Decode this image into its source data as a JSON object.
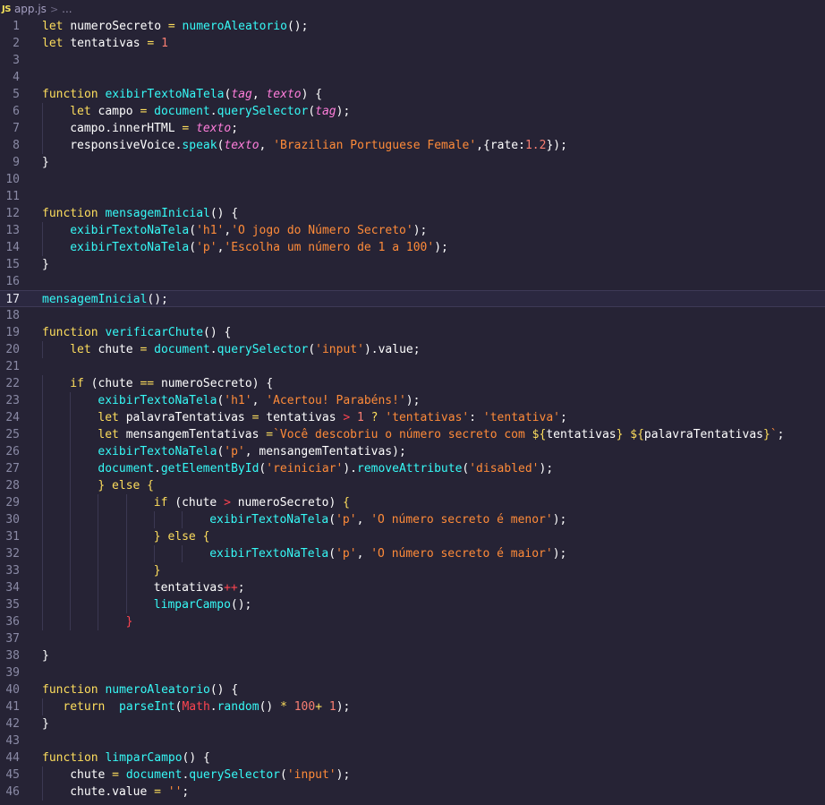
{
  "breadcrumb": {
    "icon": "JS",
    "file": "app.js",
    "separator": ">",
    "more": "..."
  },
  "editor": {
    "current_line": 17,
    "lines": [
      {
        "n": "1",
        "tokens": [
          [
            "k",
            "let "
          ],
          [
            "v",
            "numeroSecreto "
          ],
          [
            "o",
            "= "
          ],
          [
            "f",
            "numeroAleatorio"
          ],
          [
            "v",
            "();"
          ]
        ]
      },
      {
        "n": "2",
        "tokens": [
          [
            "k",
            "let "
          ],
          [
            "v",
            "tentativas "
          ],
          [
            "o",
            "= "
          ],
          [
            "n",
            "1"
          ]
        ]
      },
      {
        "n": "3",
        "tokens": []
      },
      {
        "n": "4",
        "tokens": []
      },
      {
        "n": "5",
        "tokens": [
          [
            "k",
            "function "
          ],
          [
            "f",
            "exibirTextoNaTela"
          ],
          [
            "v",
            "("
          ],
          [
            "p",
            "tag"
          ],
          [
            "v",
            ", "
          ],
          [
            "p",
            "texto"
          ],
          [
            "v",
            ") {"
          ]
        ]
      },
      {
        "n": "6",
        "indent": 1,
        "tokens": [
          [
            "k",
            "let "
          ],
          [
            "v",
            "campo "
          ],
          [
            "o",
            "= "
          ],
          [
            "f",
            "document"
          ],
          [
            "v",
            "."
          ],
          [
            "f",
            "querySelector"
          ],
          [
            "v",
            "("
          ],
          [
            "p",
            "tag"
          ],
          [
            "v",
            ");"
          ]
        ]
      },
      {
        "n": "7",
        "indent": 1,
        "tokens": [
          [
            "v",
            "campo.innerHTML "
          ],
          [
            "o",
            "= "
          ],
          [
            "p",
            "texto"
          ],
          [
            "v",
            ";"
          ]
        ]
      },
      {
        "n": "8",
        "indent": 1,
        "tokens": [
          [
            "v",
            "responsiveVoice."
          ],
          [
            "f",
            "speak"
          ],
          [
            "v",
            "("
          ],
          [
            "p",
            "texto"
          ],
          [
            "v",
            ", "
          ],
          [
            "s",
            "'Brazilian Portuguese Female'"
          ],
          [
            "v",
            ",{rate:"
          ],
          [
            "n",
            "1.2"
          ],
          [
            "v",
            "});"
          ]
        ]
      },
      {
        "n": "9",
        "tokens": [
          [
            "v",
            "}"
          ]
        ]
      },
      {
        "n": "10",
        "tokens": []
      },
      {
        "n": "11",
        "tokens": []
      },
      {
        "n": "12",
        "tokens": [
          [
            "k",
            "function "
          ],
          [
            "f",
            "mensagemInicial"
          ],
          [
            "v",
            "() {"
          ]
        ]
      },
      {
        "n": "13",
        "indent": 1,
        "tokens": [
          [
            "f",
            "exibirTextoNaTela"
          ],
          [
            "v",
            "("
          ],
          [
            "s",
            "'h1'"
          ],
          [
            "v",
            ","
          ],
          [
            "s",
            "'O jogo do Número Secreto'"
          ],
          [
            "v",
            ");"
          ]
        ]
      },
      {
        "n": "14",
        "indent": 1,
        "tokens": [
          [
            "f",
            "exibirTextoNaTela"
          ],
          [
            "v",
            "("
          ],
          [
            "s",
            "'p'"
          ],
          [
            "v",
            ","
          ],
          [
            "s",
            "'Escolha um número de 1 a 100'"
          ],
          [
            "v",
            ");"
          ]
        ]
      },
      {
        "n": "15",
        "tokens": [
          [
            "v",
            "}"
          ]
        ]
      },
      {
        "n": "16",
        "tokens": []
      },
      {
        "n": "17",
        "tokens": [
          [
            "f",
            "mensagemInicial"
          ],
          [
            "v",
            "();"
          ]
        ]
      },
      {
        "n": "18",
        "tokens": []
      },
      {
        "n": "19",
        "tokens": [
          [
            "k",
            "function "
          ],
          [
            "f",
            "verificarChute"
          ],
          [
            "v",
            "() {"
          ]
        ]
      },
      {
        "n": "20",
        "indent": 1,
        "tokens": [
          [
            "k",
            "let "
          ],
          [
            "v",
            "chute "
          ],
          [
            "o",
            "= "
          ],
          [
            "f",
            "document"
          ],
          [
            "v",
            "."
          ],
          [
            "f",
            "querySelector"
          ],
          [
            "v",
            "("
          ],
          [
            "s",
            "'input'"
          ],
          [
            "v",
            ").value;"
          ]
        ]
      },
      {
        "n": "21",
        "tokens": []
      },
      {
        "n": "22",
        "indent": 1,
        "tokens": [
          [
            "k",
            "if "
          ],
          [
            "v",
            "(chute "
          ],
          [
            "o",
            "== "
          ],
          [
            "v",
            "numeroSecreto) {"
          ]
        ]
      },
      {
        "n": "23",
        "indent": 2,
        "tokens": [
          [
            "f",
            "exibirTextoNaTela"
          ],
          [
            "v",
            "("
          ],
          [
            "s",
            "'h1'"
          ],
          [
            "v",
            ", "
          ],
          [
            "s",
            "'Acertou! Parabéns!'"
          ],
          [
            "v",
            ");"
          ]
        ]
      },
      {
        "n": "24",
        "indent": 2,
        "tokens": [
          [
            "k",
            "let "
          ],
          [
            "v",
            "palavraTentativas "
          ],
          [
            "o",
            "= "
          ],
          [
            "v",
            "tentativas "
          ],
          [
            "op",
            "> "
          ],
          [
            "n",
            "1 "
          ],
          [
            "o",
            "? "
          ],
          [
            "s",
            "'tentativas'"
          ],
          [
            "v",
            ": "
          ],
          [
            "s",
            "'tentativa'"
          ],
          [
            "v",
            ";"
          ]
        ]
      },
      {
        "n": "25",
        "indent": 2,
        "tokens": [
          [
            "k",
            "let "
          ],
          [
            "v",
            "mensangemTentativas "
          ],
          [
            "o",
            "="
          ],
          [
            "s",
            "`Você descobriu o número secreto com "
          ],
          [
            "k",
            "${"
          ],
          [
            "v",
            "tentativas"
          ],
          [
            "k",
            "} ${"
          ],
          [
            "v",
            "palavraTentativas"
          ],
          [
            "k",
            "}"
          ],
          [
            "s",
            "`"
          ],
          [
            "v",
            ";"
          ]
        ]
      },
      {
        "n": "26",
        "indent": 2,
        "tokens": [
          [
            "f",
            "exibirTextoNaTela"
          ],
          [
            "v",
            "("
          ],
          [
            "s",
            "'p'"
          ],
          [
            "v",
            ", mensangemTentativas);"
          ]
        ]
      },
      {
        "n": "27",
        "indent": 2,
        "tokens": [
          [
            "f",
            "document"
          ],
          [
            "v",
            "."
          ],
          [
            "f",
            "getElementById"
          ],
          [
            "v",
            "("
          ],
          [
            "s",
            "'reiniciar'"
          ],
          [
            "v",
            ")."
          ],
          [
            "f",
            "removeAttribute"
          ],
          [
            "v",
            "("
          ],
          [
            "s",
            "'disabled'"
          ],
          [
            "v",
            ");"
          ]
        ]
      },
      {
        "n": "28",
        "indent": 2,
        "tokens": [
          [
            "k",
            "} else {"
          ]
        ]
      },
      {
        "n": "29",
        "indent": 4,
        "tokens": [
          [
            "k",
            "if "
          ],
          [
            "v",
            "(chute "
          ],
          [
            "op",
            "> "
          ],
          [
            "v",
            "numeroSecreto) "
          ],
          [
            "k",
            "{"
          ]
        ]
      },
      {
        "n": "30",
        "indent": 6,
        "tokens": [
          [
            "f",
            "exibirTextoNaTela"
          ],
          [
            "v",
            "("
          ],
          [
            "s",
            "'p'"
          ],
          [
            "v",
            ", "
          ],
          [
            "s",
            "'O número secreto é menor'"
          ],
          [
            "v",
            ");"
          ]
        ]
      },
      {
        "n": "31",
        "indent": 4,
        "tokens": [
          [
            "k",
            "} else {"
          ]
        ]
      },
      {
        "n": "32",
        "indent": 6,
        "tokens": [
          [
            "f",
            "exibirTextoNaTela"
          ],
          [
            "v",
            "("
          ],
          [
            "s",
            "'p'"
          ],
          [
            "v",
            ", "
          ],
          [
            "s",
            "'O número secreto é maior'"
          ],
          [
            "v",
            ");"
          ]
        ]
      },
      {
        "n": "33",
        "indent": 4,
        "tokens": [
          [
            "k",
            "}"
          ]
        ]
      },
      {
        "n": "34",
        "indent": 4,
        "tokens": [
          [
            "v",
            "tentativas"
          ],
          [
            "op",
            "++"
          ],
          [
            "v",
            ";"
          ]
        ]
      },
      {
        "n": "35",
        "indent": 4,
        "tokens": [
          [
            "f",
            "limparCampo"
          ],
          [
            "v",
            "();"
          ]
        ]
      },
      {
        "n": "36",
        "indent": 3,
        "tokens": [
          [
            "op",
            "}"
          ]
        ]
      },
      {
        "n": "37",
        "tokens": []
      },
      {
        "n": "38",
        "tokens": [
          [
            "v",
            "}"
          ]
        ]
      },
      {
        "n": "39",
        "tokens": []
      },
      {
        "n": "40",
        "tokens": [
          [
            "k",
            "function "
          ],
          [
            "f",
            "numeroAleatorio"
          ],
          [
            "v",
            "() {"
          ]
        ]
      },
      {
        "n": "41",
        "indent": 1,
        "pad": "   ",
        "tokens": [
          [
            "k",
            "return  "
          ],
          [
            "f",
            "parseInt"
          ],
          [
            "v",
            "("
          ],
          [
            "c",
            "Math"
          ],
          [
            "v",
            "."
          ],
          [
            "f",
            "random"
          ],
          [
            "v",
            "() "
          ],
          [
            "o",
            "* "
          ],
          [
            "n",
            "100"
          ],
          [
            "o",
            "+ "
          ],
          [
            "n",
            "1"
          ],
          [
            "v",
            ");"
          ]
        ]
      },
      {
        "n": "42",
        "tokens": [
          [
            "v",
            "}"
          ]
        ]
      },
      {
        "n": "43",
        "tokens": []
      },
      {
        "n": "44",
        "tokens": [
          [
            "k",
            "function "
          ],
          [
            "f",
            "limparCampo"
          ],
          [
            "v",
            "() {"
          ]
        ]
      },
      {
        "n": "45",
        "indent": 1,
        "tokens": [
          [
            "v",
            "chute "
          ],
          [
            "o",
            "= "
          ],
          [
            "f",
            "document"
          ],
          [
            "v",
            "."
          ],
          [
            "f",
            "querySelector"
          ],
          [
            "v",
            "("
          ],
          [
            "s",
            "'input'"
          ],
          [
            "v",
            ");"
          ]
        ]
      },
      {
        "n": "46",
        "indent": 1,
        "tokens": [
          [
            "v",
            "chute.value "
          ],
          [
            "o",
            "= "
          ],
          [
            "s",
            "''"
          ],
          [
            "v",
            ";"
          ]
        ]
      }
    ]
  }
}
